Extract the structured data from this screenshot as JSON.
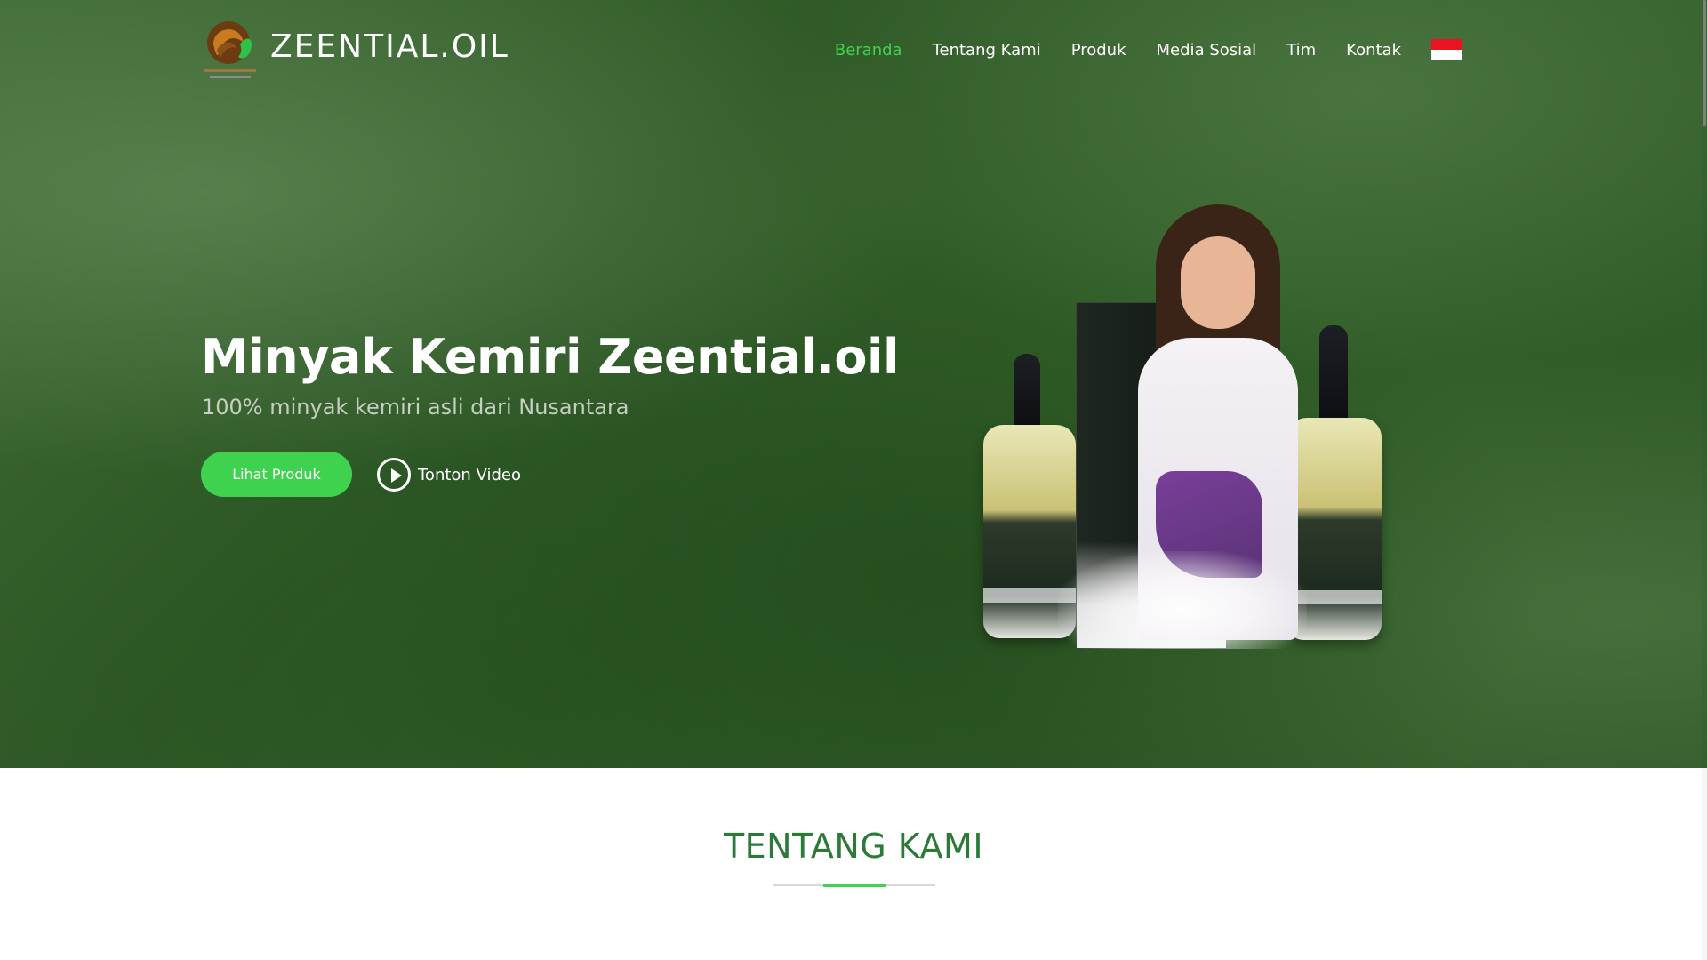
{
  "header": {
    "logo_text": "ZEENTIAL.OIL",
    "nav": {
      "items": [
        {
          "label": "Beranda",
          "active": true
        },
        {
          "label": "Tentang Kami",
          "active": false
        },
        {
          "label": "Produk",
          "active": false
        },
        {
          "label": "Media Sosial",
          "active": false
        },
        {
          "label": "Tim",
          "active": false
        },
        {
          "label": "Kontak",
          "active": false
        }
      ],
      "language_flag": "indonesia-flag"
    }
  },
  "hero": {
    "title": "Minyak Kemiri Zeential.oil",
    "subtitle": "100% minyak kemiri asli dari Nusantara",
    "primary_button": "Lihat Produk",
    "video_link": "Tonton Video"
  },
  "about": {
    "heading": "TENTANG KAMI"
  },
  "colors": {
    "accent_green": "#3ed24e",
    "heading_green": "#2c7a38",
    "hero_background": "#2f5a27",
    "flag_red": "#e8141f"
  },
  "icons": {
    "play": "play-circle-icon",
    "logo": "logo-emblem-icon"
  }
}
